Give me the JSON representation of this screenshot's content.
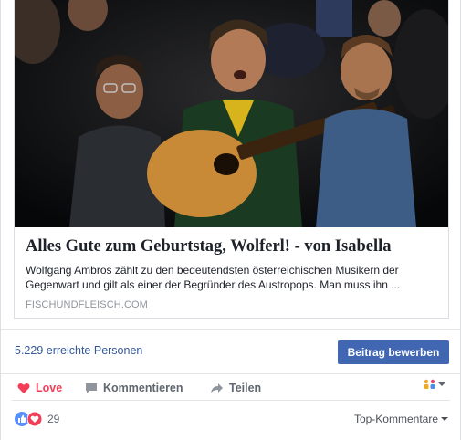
{
  "post": {
    "link_card": {
      "title": "Alles Gute zum Geburtstag, Wolferl! - von Isabella",
      "description": "Wolfgang Ambros zählt zu den bedeutendsten österreichischen Musikern der Gegenwart und gilt als einer der Begründer des Austropops. Man muss ihn ...",
      "domain": "FISCHUNDFLEISCH.COM",
      "image_alt": "Video still: three men on stage, the man in the center playing an acoustic guitar"
    },
    "reach": {
      "text": "5.229 erreichte Personen",
      "boost_label": "Beitrag bewerben"
    },
    "actions": {
      "love_label": "Love",
      "comment_label": "Kommentieren",
      "share_label": "Teilen",
      "audience_icon": "people-icon"
    },
    "reactions": {
      "count": "29",
      "icons": [
        "like-icon",
        "love-icon"
      ],
      "sort_label": "Top-Kommentare"
    }
  },
  "colors": {
    "link_blue": "#365899",
    "button_blue": "#4267b2",
    "love_red": "#f33e58",
    "muted": "#606770"
  }
}
